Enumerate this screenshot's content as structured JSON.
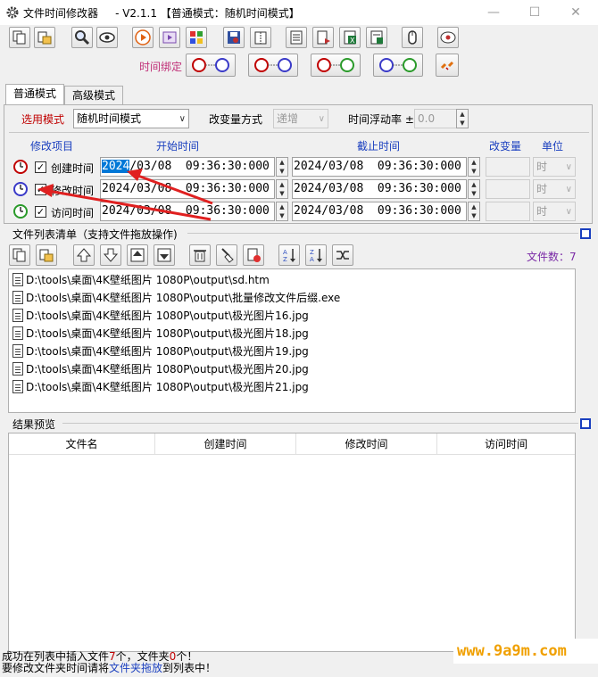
{
  "window": {
    "title": "文件时间修改器     - V2.1.1 【普通模式：随机时间模式】",
    "minimize": "—",
    "maximize": "☐",
    "close": "✕"
  },
  "toolbar": {
    "bind_label": "时间绑定"
  },
  "tabs": [
    {
      "label": "普通模式",
      "active": true
    },
    {
      "label": "高级模式",
      "active": false
    }
  ],
  "options": {
    "mode_label": "选用模式",
    "mode_value": "随机时间模式",
    "change_method_label": "改变量方式",
    "change_method_value": "递增",
    "float_rate_label": "时间浮动率 ±",
    "float_rate_value": "0.0"
  },
  "grid_headers": {
    "item": "修改项目",
    "start": "开始时间",
    "end": "截止时间",
    "change": "改变量",
    "unit": "单位"
  },
  "time_rows": [
    {
      "label": "创建时间",
      "checked": "✓",
      "start_year": "2024",
      "start_rest": "/03/08  09:36:30:000",
      "end": "2024/03/08  09:36:30:000",
      "unit": "时",
      "icon_color": "#c00000"
    },
    {
      "label": "修改时间",
      "checked": "✓",
      "start_year": "2024",
      "start_rest": "/03/08  09:36:30:000",
      "end": "2024/03/08  09:36:30:000",
      "unit": "时",
      "icon_color": "#3a3ac8"
    },
    {
      "label": "访问时间",
      "checked": "✓",
      "start_year": "2024",
      "start_rest": "/03/08  09:36:30:000",
      "end": "2024/03/08  09:36:30:000",
      "unit": "时",
      "icon_color": "#2a9a2a"
    }
  ],
  "file_list": {
    "title": "文件列表清单（支持文件拖放操作)",
    "count_label": "文件数：7",
    "files": [
      "D:\\tools\\桌面\\4K壁纸图片 1080P\\output\\sd.htm",
      "D:\\tools\\桌面\\4K壁纸图片 1080P\\output\\批量修改文件后缀.exe",
      "D:\\tools\\桌面\\4K壁纸图片 1080P\\output\\极光图片16.jpg",
      "D:\\tools\\桌面\\4K壁纸图片 1080P\\output\\极光图片18.jpg",
      "D:\\tools\\桌面\\4K壁纸图片 1080P\\output\\极光图片19.jpg",
      "D:\\tools\\桌面\\4K壁纸图片 1080P\\output\\极光图片20.jpg",
      "D:\\tools\\桌面\\4K壁纸图片 1080P\\output\\极光图片21.jpg"
    ]
  },
  "result_preview": {
    "title": "结果预览",
    "columns": [
      "文件名",
      "创建时间",
      "修改时间",
      "访问时间"
    ]
  },
  "status": {
    "line1_a": "成功在列表中插入文件",
    "line1_b": "7",
    "line1_c": "个，文件夹",
    "line1_d": "0",
    "line1_e": "个！",
    "line2_a": "要修改文件夹时间请将",
    "line2_b": "文件夹拖放",
    "line2_c": "到列表中！"
  },
  "watermark": "www.9a9m.com",
  "colors": {
    "accent_red": "#c00000",
    "accent_blue": "#1a3fbf",
    "selection_blue": "#0078d7",
    "arrow_red": "#e02020"
  }
}
